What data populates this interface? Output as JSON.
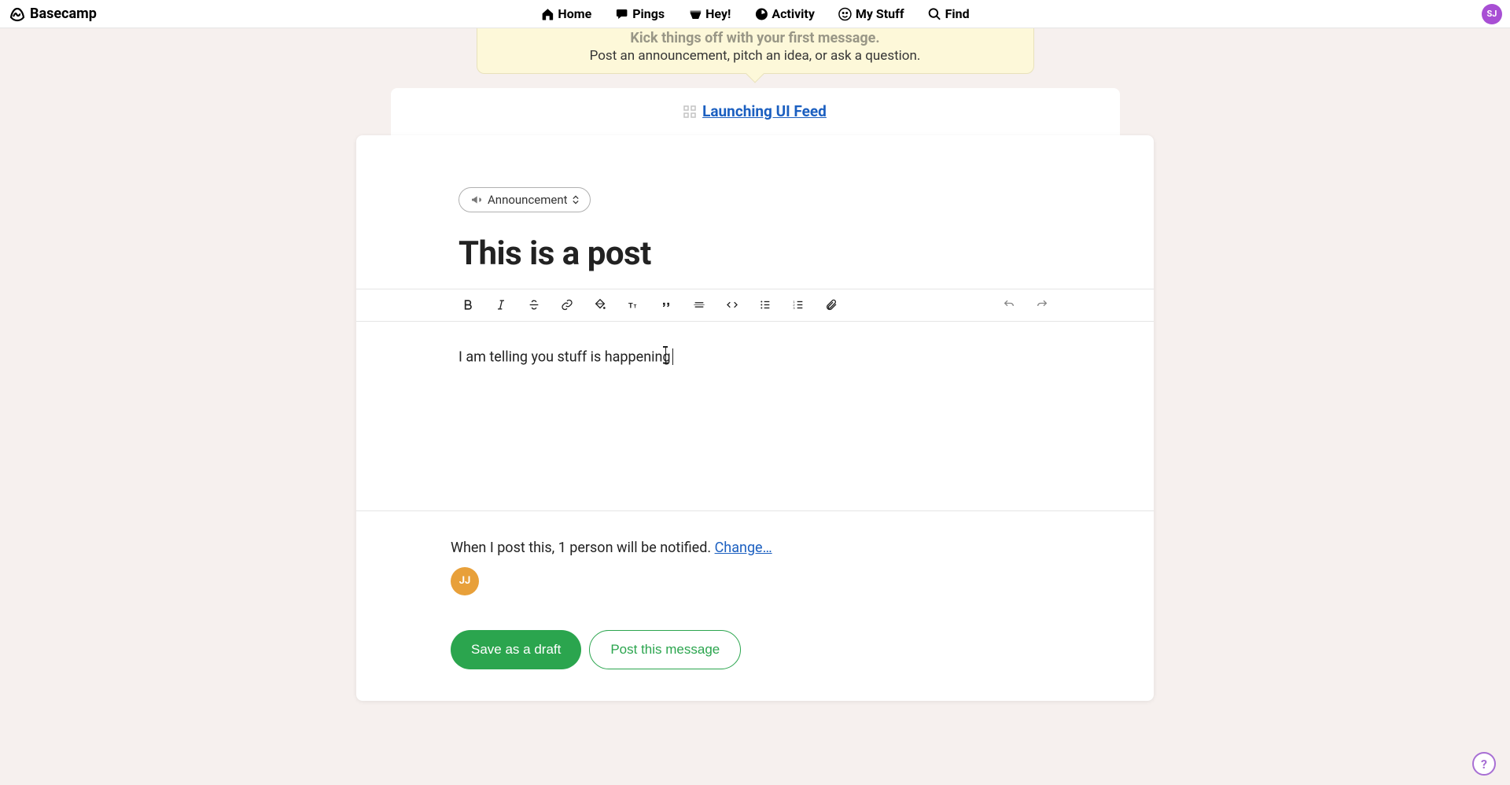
{
  "brand": "Basecamp",
  "nav": {
    "home": "Home",
    "pings": "Pings",
    "hey": "Hey!",
    "activity": "Activity",
    "mystuff": "My Stuff",
    "find": "Find"
  },
  "user": {
    "initials": "SJ"
  },
  "tip": {
    "title": "Kick things off with your first message.",
    "subtitle": "Post an announcement, pitch an idea, or ask a question."
  },
  "project_link": "Launching UI Feed",
  "editor": {
    "category": "Announcement",
    "title": "This is a post",
    "body": "I am telling you stuff is happening"
  },
  "notify": {
    "prefix": "When I post this, 1 person will be notified. ",
    "change": "Change…",
    "avatar_initials": "JJ"
  },
  "actions": {
    "draft": "Save as a draft",
    "post": "Post this message"
  },
  "help": "?"
}
